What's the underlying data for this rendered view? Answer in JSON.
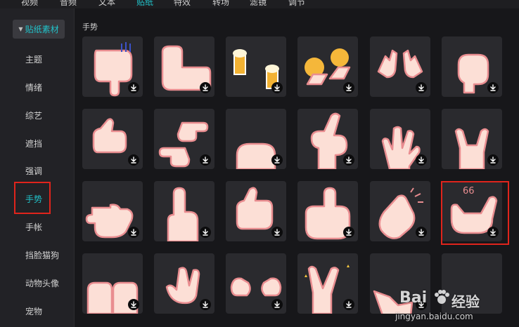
{
  "top_tabs": [
    "视频",
    "音频",
    "文本",
    "贴纸",
    "特效",
    "转场",
    "滤镜",
    "调节"
  ],
  "top_tab_active": "贴纸",
  "sidebar": {
    "header": "贴纸素材",
    "items": [
      "主题",
      "情绪",
      "综艺",
      "遮挡",
      "强调",
      "手势",
      "手帐",
      "挡脸猫狗",
      "动物头像",
      "宠物"
    ],
    "active": "手势"
  },
  "section_title": "手势",
  "stickers": [
    "thumbs-down",
    "flexed-arm",
    "beer-cheers",
    "explosion-fists",
    "double-peace",
    "raised-fist",
    "thumb-up-side",
    "pointing-hands",
    "fist",
    "point-up-sparkle",
    "spread-fingers",
    "rock-horns",
    "pointing-left",
    "index-up",
    "thumbs-up",
    "pointing-up",
    "clapping",
    "shaka-hand",
    "two-hands",
    "waving-hand",
    "pinching-hands",
    "victory-sparkle",
    "tip-hand",
    "empty"
  ],
  "highlight_item": "手势",
  "highlight_card": "shaka-hand",
  "watermark": {
    "brand": "Bai",
    "brand2": "经验",
    "url": "jingyan.baidu.com"
  },
  "colors": {
    "accent": "#21c2c9",
    "highlight": "#e0241c",
    "skin": "#fcdfd6",
    "outline": "#e98d90"
  }
}
